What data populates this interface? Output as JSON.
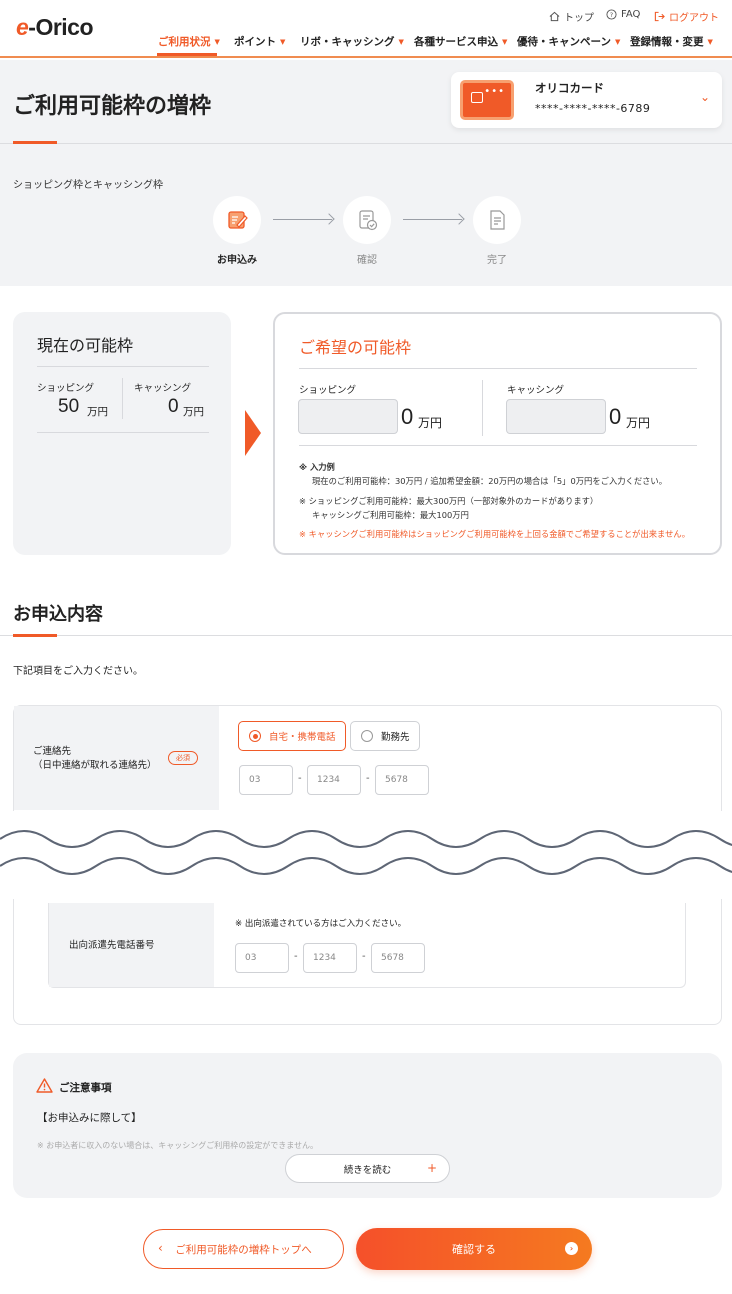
{
  "header": {
    "logo_prefix": "e",
    "logo_text": "-Orico",
    "util": {
      "top": "トップ",
      "faq": "FAQ",
      "logout": "ログアウト"
    },
    "nav": [
      "ご利用状況",
      "ポイント",
      "リボ・キャッシング",
      "各種サービス申込",
      "優待・キャンペーン",
      "登録情報・変更"
    ]
  },
  "page": {
    "title": "ご利用可能枠の増枠",
    "card": {
      "name": "オリコカード",
      "number": "****-****-****-6789"
    },
    "subheading": "ショッピング枠とキャッシング枠",
    "steps": [
      "お申込み",
      "確認",
      "完了"
    ]
  },
  "current": {
    "title": "現在の可能枠",
    "shopping_label": "ショッピング",
    "shopping_value": "50",
    "cashing_label": "キャッシング",
    "cashing_value": "0",
    "unit": "万円"
  },
  "wish": {
    "title": "ご希望の可能枠",
    "shopping_label": "ショッピング",
    "cashing_label": "キャッシング",
    "shopping_value": "0",
    "cashing_value": "0",
    "unit": "万円",
    "note1_head": "※ 入力例",
    "note1_body": "現在のご利用可能枠：30万円 / 追加希望金額：20万円の場合は「5」0万円をご入力ください。",
    "note2_line1": "※ ショッピングご利用可能枠：最大300万円（一部対象外のカードがあります）",
    "note2_line2": "キャッシングご利用可能枠：最大100万円",
    "note3": "※ キャッシングご利用可能枠はショッピングご利用可能枠を上回る金額でご希望することが出来ません。"
  },
  "application": {
    "title": "お申込内容",
    "instruction": "下記項目をご入力ください。",
    "contact_label_1": "ご連絡先",
    "contact_label_2": "（日中連絡が取れる連絡先）",
    "required": "必須",
    "radio_home": "自宅・携帯電話",
    "radio_work": "勤務先",
    "tel_placeholders": [
      "03",
      "1234",
      "5678"
    ],
    "dispatch_label": "出向派遣先電話番号",
    "dispatch_note": "※ 出向派遣されている方はご入力ください。"
  },
  "notice": {
    "title": "ご注意事項",
    "subtitle": "【お申込みに際して】",
    "faded": "※ お申込者に収入のない場合は、キャッシングご利用枠の設定ができません。",
    "read_more": "続きを読む"
  },
  "buttons": {
    "back": "ご利用可能枠の増枠トップへ",
    "confirm": "確認する"
  },
  "colors": {
    "accent": "#f05a28",
    "panel": "#f2f3f5"
  }
}
